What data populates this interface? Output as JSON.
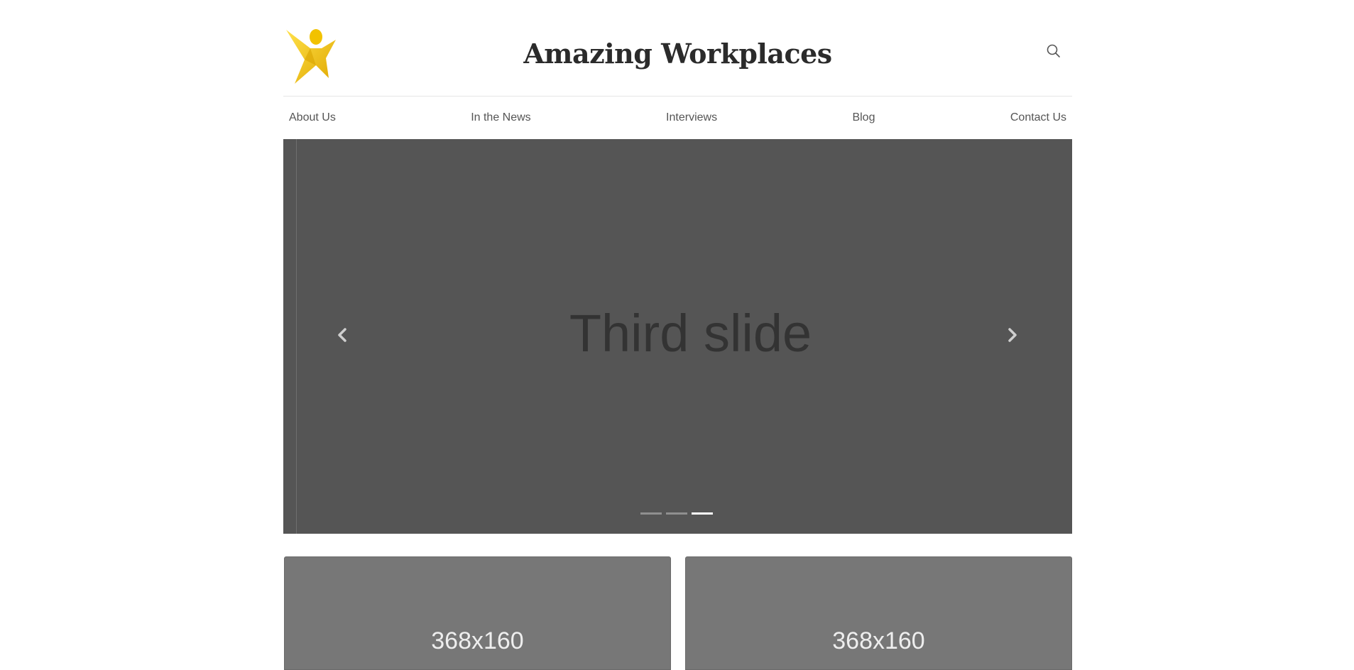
{
  "header": {
    "title": "Amazing Workplaces",
    "logo_icon": "star-person-logo-icon",
    "search_icon": "search-icon",
    "logo_color": "#F2C200"
  },
  "nav": {
    "items": [
      {
        "label": "About Us"
      },
      {
        "label": "In the News"
      },
      {
        "label": "Interviews"
      },
      {
        "label": "Blog"
      },
      {
        "label": "Contact Us"
      }
    ]
  },
  "carousel": {
    "slide_text": "Third slide",
    "slide_background": "#555555",
    "prev_icon": "chevron-left-icon",
    "next_icon": "chevron-right-icon",
    "slide_count": 3,
    "active_slide": 3
  },
  "cards": [
    {
      "label": "368x160"
    },
    {
      "label": "368x160"
    }
  ]
}
